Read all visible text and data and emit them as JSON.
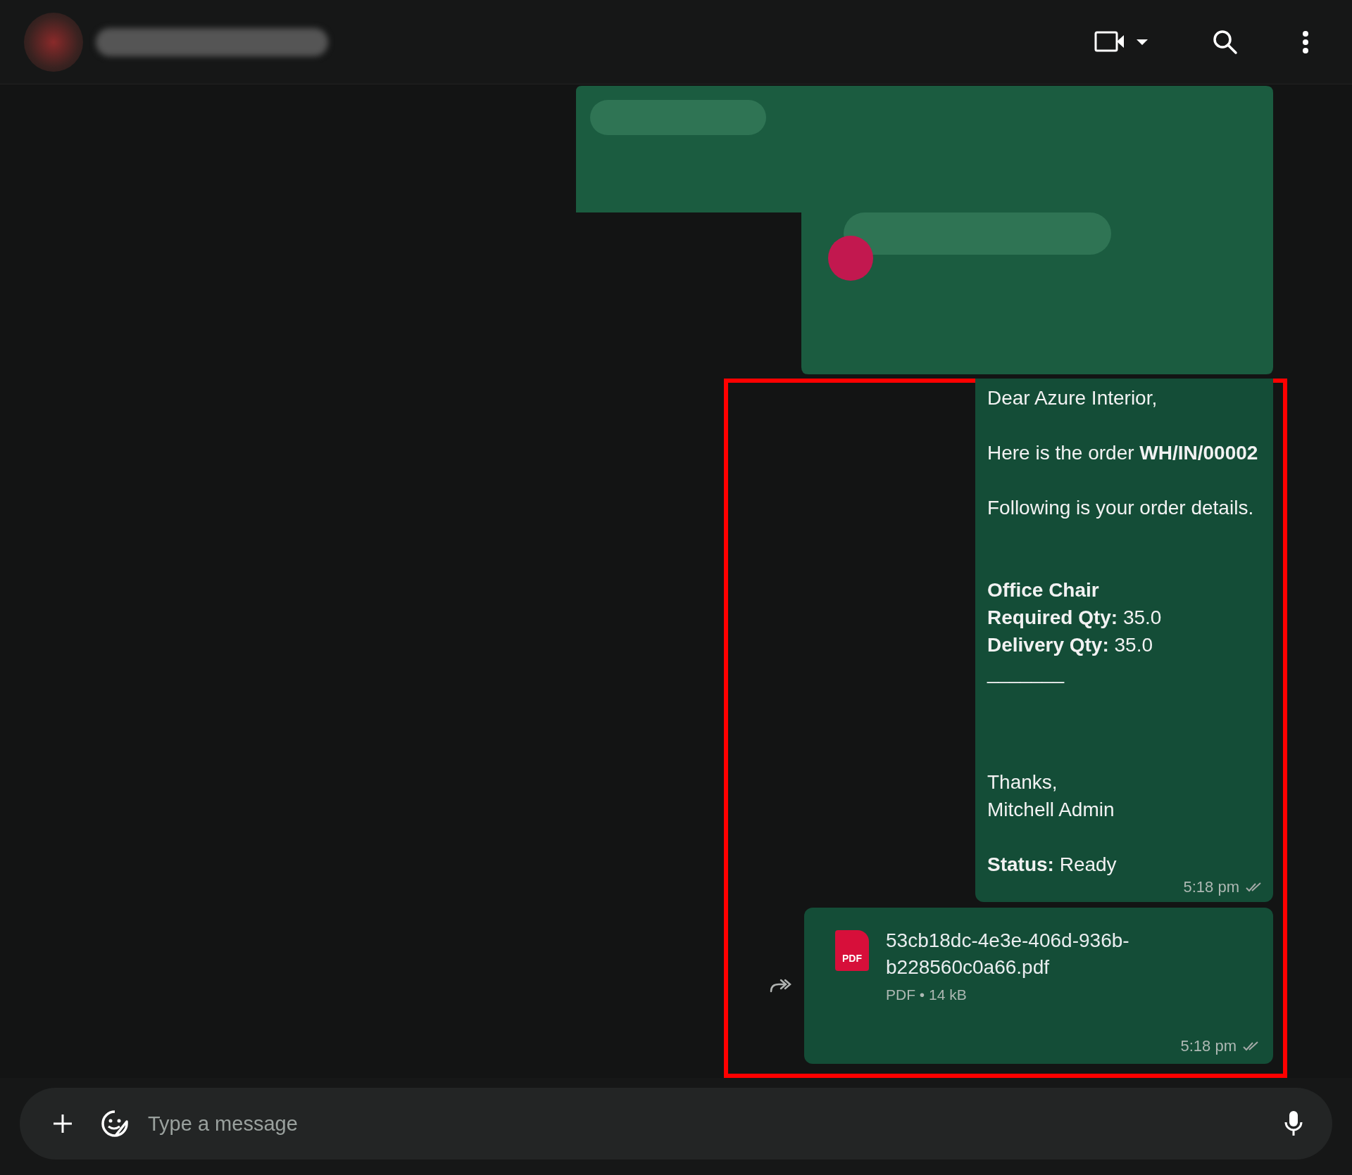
{
  "messages": [
    {
      "kind": "text",
      "text": "Dear Azure Interior,\n\nHere is the order **WH/IN/00002**\n\nFollowing is your order details.\n\n\n**Office Chair**\n**Required Qty:** 35.0\n**Delivery Qty:** 35.0\n_______\n\n\n\nThanks,\nMitchell Admin\n\n**Status:** Ready",
      "time": "5:18 pm",
      "delivered": true
    },
    {
      "kind": "document",
      "file_name": "53cb18dc-4e3e-406d-936b-b228560c0a66.pdf",
      "file_badge": "PDF",
      "meta": "PDF • 14 kB",
      "time": "5:18 pm",
      "delivered": true
    }
  ],
  "composer": {
    "placeholder": "Type a message"
  }
}
